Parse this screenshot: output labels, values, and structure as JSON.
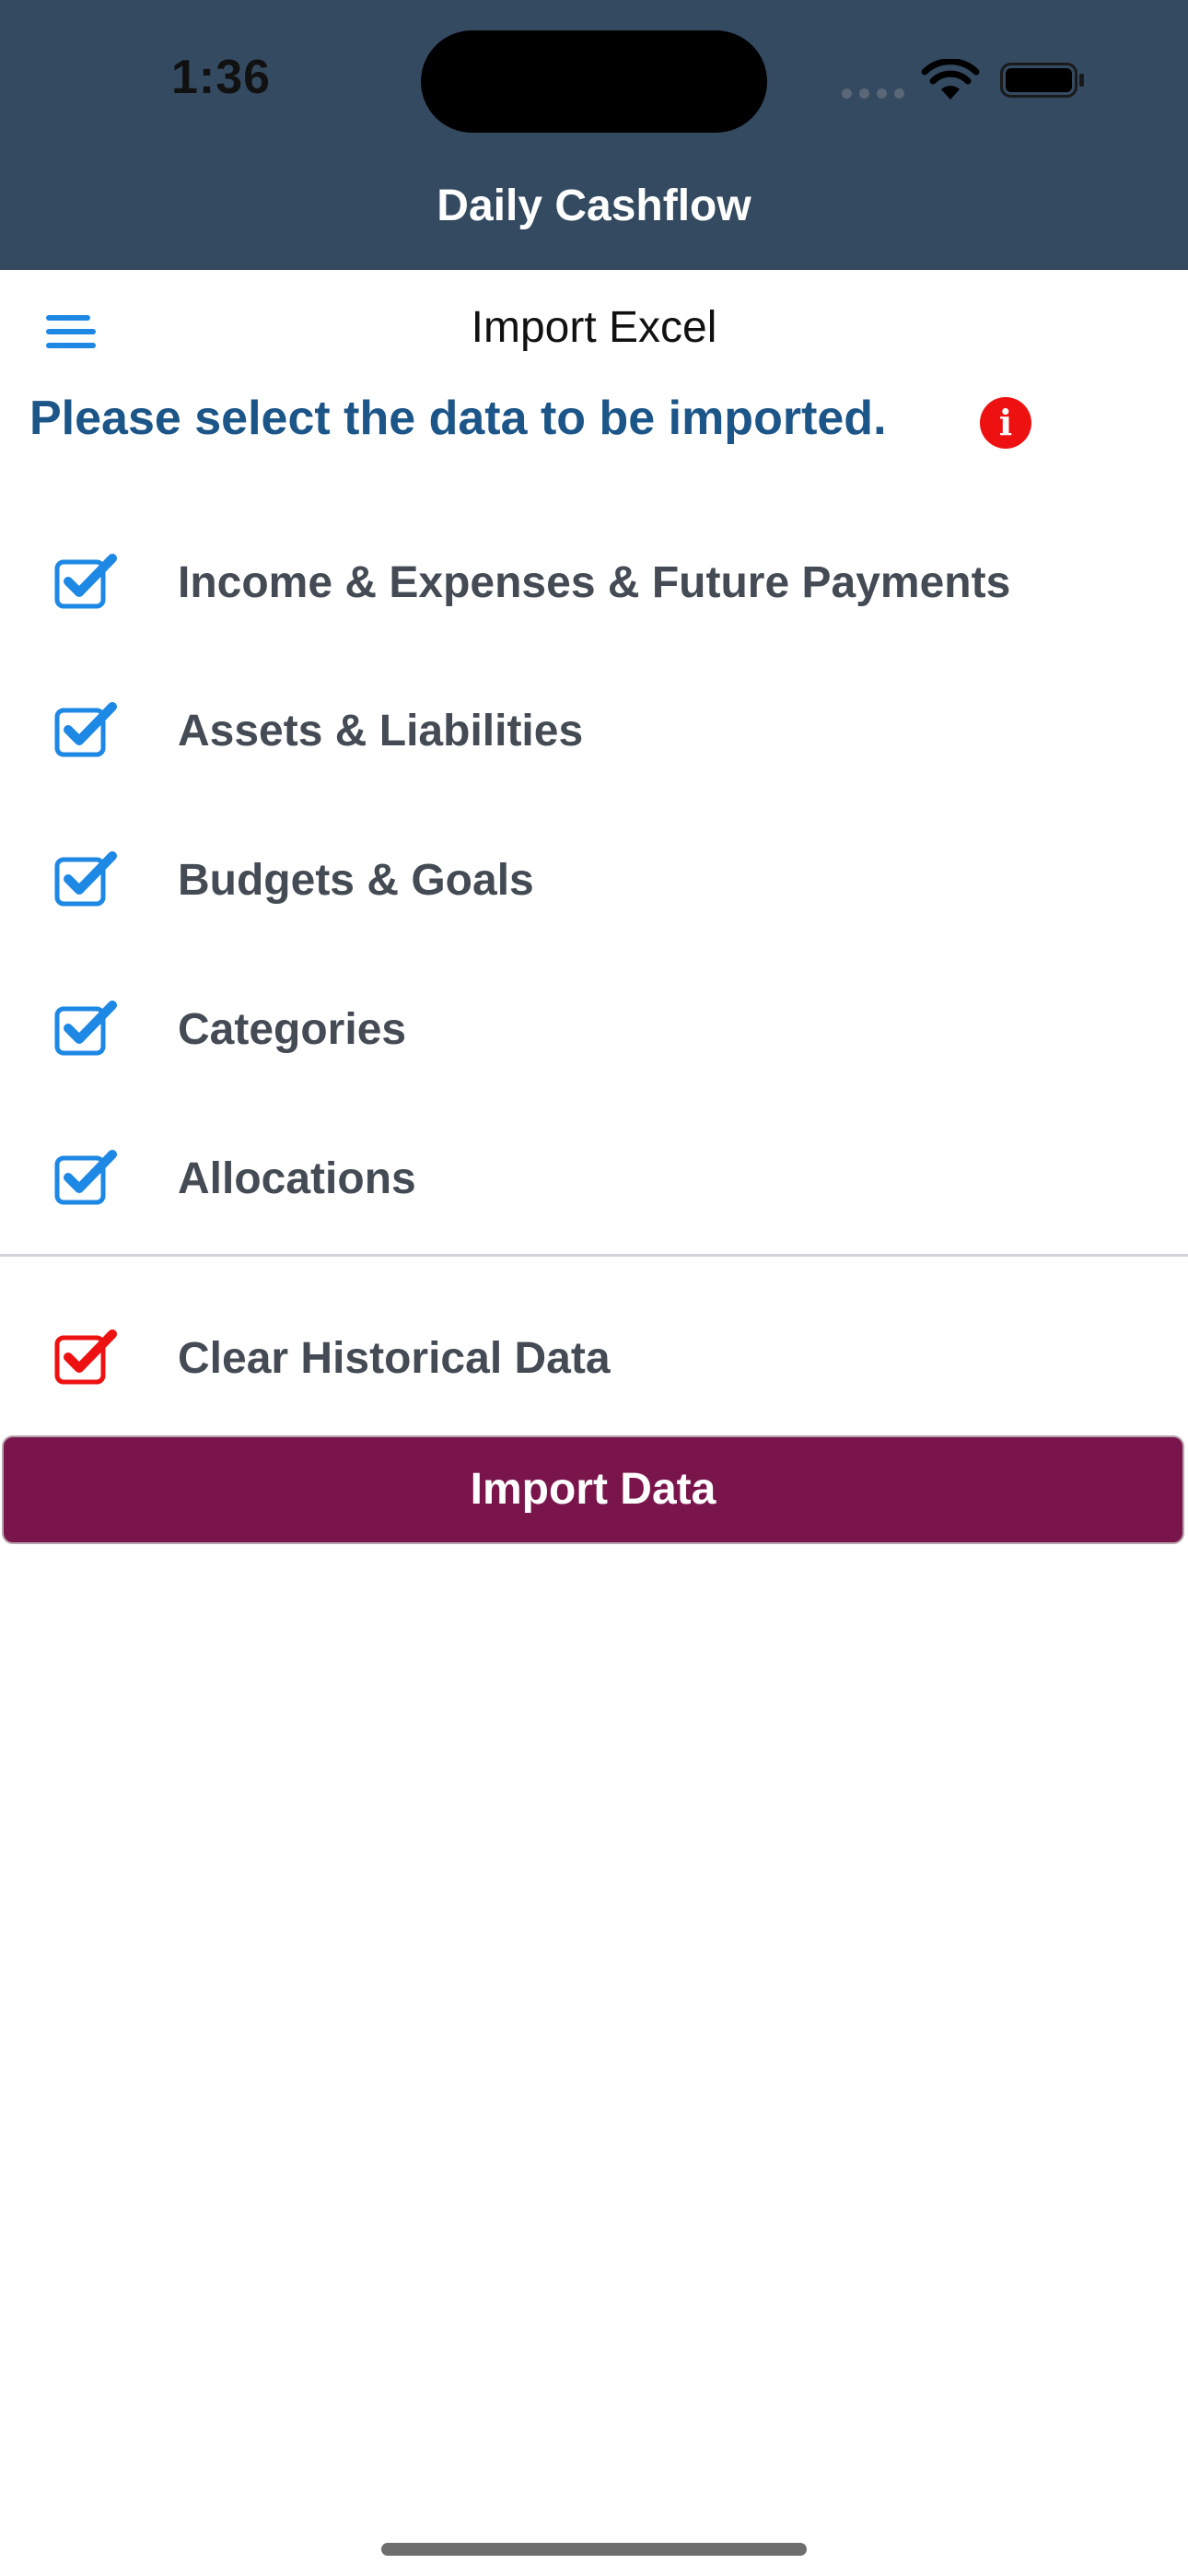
{
  "status_bar": {
    "time": "1:36"
  },
  "header": {
    "app_title": "Daily Cashflow"
  },
  "page": {
    "title": "Import Excel",
    "instruction": "Please select the data to be imported.",
    "info_glyph": "i"
  },
  "options": [
    {
      "label": "Income & Expenses & Future Payments",
      "checked": true,
      "color": "#1e88e5"
    },
    {
      "label": "Assets & Liabilities",
      "checked": true,
      "color": "#1e88e5"
    },
    {
      "label": "Budgets & Goals",
      "checked": true,
      "color": "#1e88e5"
    },
    {
      "label": "Categories",
      "checked": true,
      "color": "#1e88e5"
    },
    {
      "label": "Allocations",
      "checked": true,
      "color": "#1e88e5"
    }
  ],
  "clear_option": {
    "label": "Clear Historical Data",
    "checked": true,
    "color": "#ee1111"
  },
  "import_button": {
    "label": "Import Data"
  },
  "colors": {
    "header_bg": "#344a61",
    "accent_blue": "#1e88e5",
    "instruction_text": "#1c5588",
    "danger_red": "#ee1111",
    "primary_button": "#7a154b"
  },
  "icons": {
    "menu": "hamburger-menu-icon",
    "info": "info-icon",
    "checkbox": "checkbox-checked-icon",
    "wifi": "wifi-icon",
    "battery": "battery-icon"
  }
}
